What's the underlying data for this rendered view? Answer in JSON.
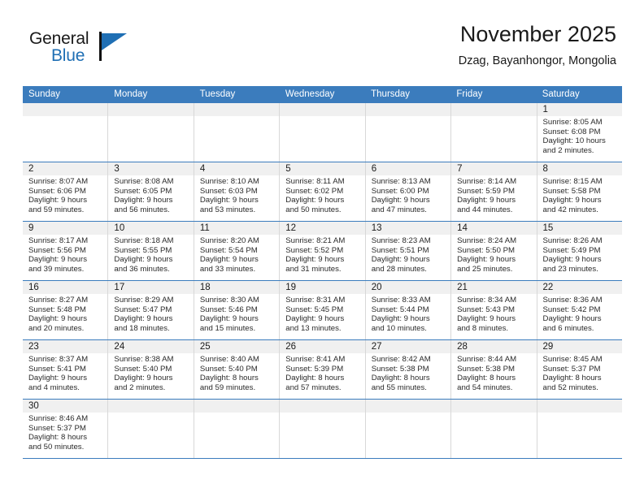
{
  "brand": {
    "name_top": "General",
    "name_bottom": "Blue",
    "flag_icon": "triangle-flag-icon",
    "accent_color": "#1f6fb4"
  },
  "header": {
    "title": "November 2025",
    "subtitle": "Dzag, Bayanhongor, Mongolia"
  },
  "calendar": {
    "header_bg": "#3b7cbd",
    "day_number_bg": "#f0f0f0",
    "row_separator_color": "#3b7cbd",
    "weekdays": [
      "Sunday",
      "Monday",
      "Tuesday",
      "Wednesday",
      "Thursday",
      "Friday",
      "Saturday"
    ],
    "weeks": [
      [
        {
          "day": "",
          "lines": []
        },
        {
          "day": "",
          "lines": []
        },
        {
          "day": "",
          "lines": []
        },
        {
          "day": "",
          "lines": []
        },
        {
          "day": "",
          "lines": []
        },
        {
          "day": "",
          "lines": []
        },
        {
          "day": "1",
          "lines": [
            "Sunrise: 8:05 AM",
            "Sunset: 6:08 PM",
            "Daylight: 10 hours",
            "and 2 minutes."
          ]
        }
      ],
      [
        {
          "day": "2",
          "lines": [
            "Sunrise: 8:07 AM",
            "Sunset: 6:06 PM",
            "Daylight: 9 hours",
            "and 59 minutes."
          ]
        },
        {
          "day": "3",
          "lines": [
            "Sunrise: 8:08 AM",
            "Sunset: 6:05 PM",
            "Daylight: 9 hours",
            "and 56 minutes."
          ]
        },
        {
          "day": "4",
          "lines": [
            "Sunrise: 8:10 AM",
            "Sunset: 6:03 PM",
            "Daylight: 9 hours",
            "and 53 minutes."
          ]
        },
        {
          "day": "5",
          "lines": [
            "Sunrise: 8:11 AM",
            "Sunset: 6:02 PM",
            "Daylight: 9 hours",
            "and 50 minutes."
          ]
        },
        {
          "day": "6",
          "lines": [
            "Sunrise: 8:13 AM",
            "Sunset: 6:00 PM",
            "Daylight: 9 hours",
            "and 47 minutes."
          ]
        },
        {
          "day": "7",
          "lines": [
            "Sunrise: 8:14 AM",
            "Sunset: 5:59 PM",
            "Daylight: 9 hours",
            "and 44 minutes."
          ]
        },
        {
          "day": "8",
          "lines": [
            "Sunrise: 8:15 AM",
            "Sunset: 5:58 PM",
            "Daylight: 9 hours",
            "and 42 minutes."
          ]
        }
      ],
      [
        {
          "day": "9",
          "lines": [
            "Sunrise: 8:17 AM",
            "Sunset: 5:56 PM",
            "Daylight: 9 hours",
            "and 39 minutes."
          ]
        },
        {
          "day": "10",
          "lines": [
            "Sunrise: 8:18 AM",
            "Sunset: 5:55 PM",
            "Daylight: 9 hours",
            "and 36 minutes."
          ]
        },
        {
          "day": "11",
          "lines": [
            "Sunrise: 8:20 AM",
            "Sunset: 5:54 PM",
            "Daylight: 9 hours",
            "and 33 minutes."
          ]
        },
        {
          "day": "12",
          "lines": [
            "Sunrise: 8:21 AM",
            "Sunset: 5:52 PM",
            "Daylight: 9 hours",
            "and 31 minutes."
          ]
        },
        {
          "day": "13",
          "lines": [
            "Sunrise: 8:23 AM",
            "Sunset: 5:51 PM",
            "Daylight: 9 hours",
            "and 28 minutes."
          ]
        },
        {
          "day": "14",
          "lines": [
            "Sunrise: 8:24 AM",
            "Sunset: 5:50 PM",
            "Daylight: 9 hours",
            "and 25 minutes."
          ]
        },
        {
          "day": "15",
          "lines": [
            "Sunrise: 8:26 AM",
            "Sunset: 5:49 PM",
            "Daylight: 9 hours",
            "and 23 minutes."
          ]
        }
      ],
      [
        {
          "day": "16",
          "lines": [
            "Sunrise: 8:27 AM",
            "Sunset: 5:48 PM",
            "Daylight: 9 hours",
            "and 20 minutes."
          ]
        },
        {
          "day": "17",
          "lines": [
            "Sunrise: 8:29 AM",
            "Sunset: 5:47 PM",
            "Daylight: 9 hours",
            "and 18 minutes."
          ]
        },
        {
          "day": "18",
          "lines": [
            "Sunrise: 8:30 AM",
            "Sunset: 5:46 PM",
            "Daylight: 9 hours",
            "and 15 minutes."
          ]
        },
        {
          "day": "19",
          "lines": [
            "Sunrise: 8:31 AM",
            "Sunset: 5:45 PM",
            "Daylight: 9 hours",
            "and 13 minutes."
          ]
        },
        {
          "day": "20",
          "lines": [
            "Sunrise: 8:33 AM",
            "Sunset: 5:44 PM",
            "Daylight: 9 hours",
            "and 10 minutes."
          ]
        },
        {
          "day": "21",
          "lines": [
            "Sunrise: 8:34 AM",
            "Sunset: 5:43 PM",
            "Daylight: 9 hours",
            "and 8 minutes."
          ]
        },
        {
          "day": "22",
          "lines": [
            "Sunrise: 8:36 AM",
            "Sunset: 5:42 PM",
            "Daylight: 9 hours",
            "and 6 minutes."
          ]
        }
      ],
      [
        {
          "day": "23",
          "lines": [
            "Sunrise: 8:37 AM",
            "Sunset: 5:41 PM",
            "Daylight: 9 hours",
            "and 4 minutes."
          ]
        },
        {
          "day": "24",
          "lines": [
            "Sunrise: 8:38 AM",
            "Sunset: 5:40 PM",
            "Daylight: 9 hours",
            "and 2 minutes."
          ]
        },
        {
          "day": "25",
          "lines": [
            "Sunrise: 8:40 AM",
            "Sunset: 5:40 PM",
            "Daylight: 8 hours",
            "and 59 minutes."
          ]
        },
        {
          "day": "26",
          "lines": [
            "Sunrise: 8:41 AM",
            "Sunset: 5:39 PM",
            "Daylight: 8 hours",
            "and 57 minutes."
          ]
        },
        {
          "day": "27",
          "lines": [
            "Sunrise: 8:42 AM",
            "Sunset: 5:38 PM",
            "Daylight: 8 hours",
            "and 55 minutes."
          ]
        },
        {
          "day": "28",
          "lines": [
            "Sunrise: 8:44 AM",
            "Sunset: 5:38 PM",
            "Daylight: 8 hours",
            "and 54 minutes."
          ]
        },
        {
          "day": "29",
          "lines": [
            "Sunrise: 8:45 AM",
            "Sunset: 5:37 PM",
            "Daylight: 8 hours",
            "and 52 minutes."
          ]
        }
      ],
      [
        {
          "day": "30",
          "lines": [
            "Sunrise: 8:46 AM",
            "Sunset: 5:37 PM",
            "Daylight: 8 hours",
            "and 50 minutes."
          ]
        },
        {
          "day": "",
          "lines": []
        },
        {
          "day": "",
          "lines": []
        },
        {
          "day": "",
          "lines": []
        },
        {
          "day": "",
          "lines": []
        },
        {
          "day": "",
          "lines": []
        },
        {
          "day": "",
          "lines": []
        }
      ]
    ]
  }
}
